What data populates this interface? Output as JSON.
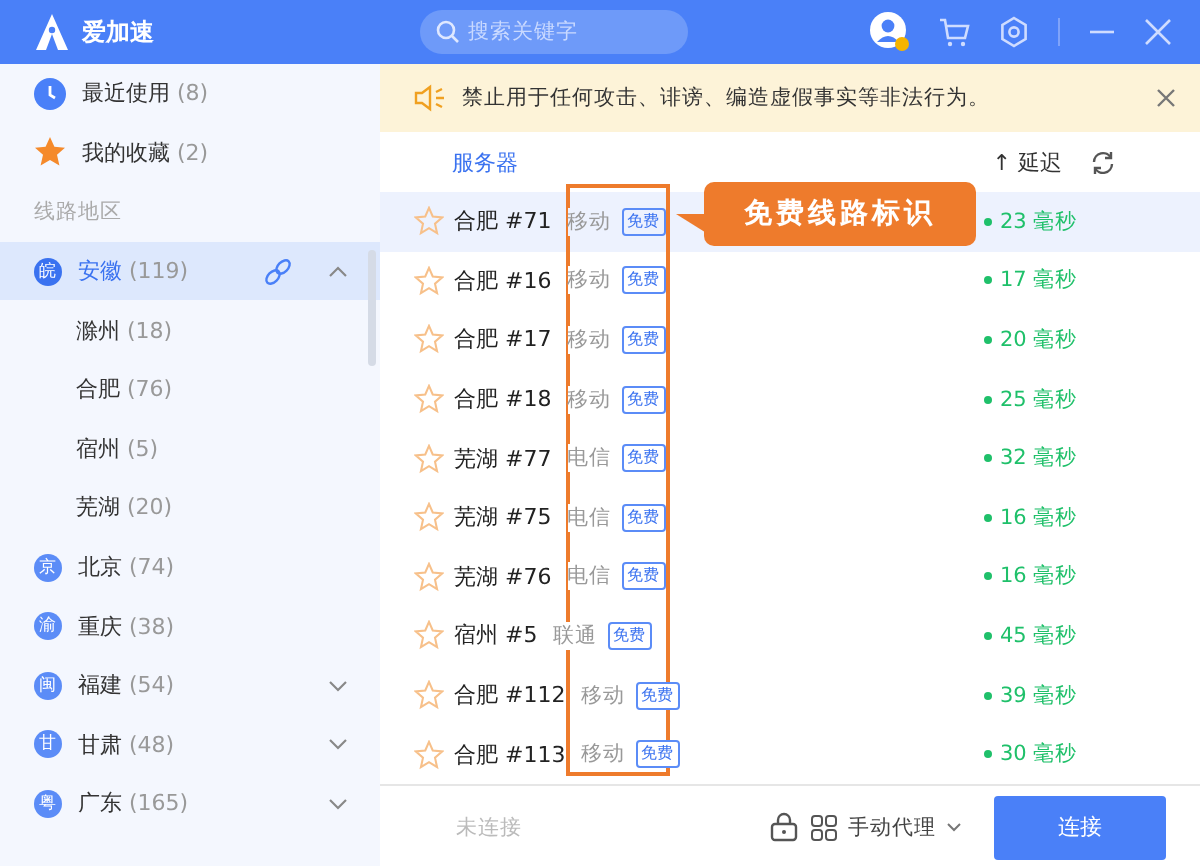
{
  "header": {
    "app_name": "爱加速",
    "search": {
      "placeholder": "搜索关键字"
    }
  },
  "sidebar": {
    "items": [
      {
        "kind": "recent",
        "label": "最近使用",
        "count": "(8)"
      },
      {
        "kind": "favorite",
        "label": "我的收藏",
        "count": "(2)"
      }
    ],
    "section_title": "线路地区",
    "regions": [
      {
        "badge": "皖",
        "label": "安徽",
        "count": "(119)",
        "selected": true,
        "expanded": true,
        "children": [
          {
            "label": "滁州",
            "count": "(18)"
          },
          {
            "label": "合肥",
            "count": "(76)"
          },
          {
            "label": "宿州",
            "count": "(5)"
          },
          {
            "label": "芜湖",
            "count": "(20)"
          }
        ]
      },
      {
        "badge": "京",
        "label": "北京",
        "count": "(74)",
        "selected": false,
        "expanded": false
      },
      {
        "badge": "渝",
        "label": "重庆",
        "count": "(38)",
        "selected": false,
        "expanded": false
      },
      {
        "badge": "闽",
        "label": "福建",
        "count": "(54)",
        "selected": false,
        "expanded": false,
        "expandable": true
      },
      {
        "badge": "甘",
        "label": "甘肃",
        "count": "(48)",
        "selected": false,
        "expanded": false,
        "expandable": true
      },
      {
        "badge": "粤",
        "label": "广东",
        "count": "(165)",
        "selected": false,
        "expanded": false,
        "expandable": true
      }
    ]
  },
  "notice": {
    "text": "禁止用于任何攻击、诽谤、编造虚假事实等非法行为。"
  },
  "list_header": {
    "server": "服务器",
    "latency": "延迟",
    "sort_arrow": "↑"
  },
  "servers": [
    {
      "name": "合肥 #71",
      "carrier": "移动",
      "tag": "免费",
      "latency": "23 毫秒",
      "selected": true
    },
    {
      "name": "合肥 #16",
      "carrier": "移动",
      "tag": "免费",
      "latency": "17 毫秒",
      "selected": false
    },
    {
      "name": "合肥 #17",
      "carrier": "移动",
      "tag": "免费",
      "latency": "20 毫秒",
      "selected": false
    },
    {
      "name": "合肥 #18",
      "carrier": "移动",
      "tag": "免费",
      "latency": "25 毫秒",
      "selected": false
    },
    {
      "name": "芜湖 #77",
      "carrier": "电信",
      "tag": "免费",
      "latency": "32 毫秒",
      "selected": false
    },
    {
      "name": "芜湖 #75",
      "carrier": "电信",
      "tag": "免费",
      "latency": "16 毫秒",
      "selected": false
    },
    {
      "name": "芜湖 #76",
      "carrier": "电信",
      "tag": "免费",
      "latency": "16 毫秒",
      "selected": false
    },
    {
      "name": "宿州 #5",
      "carrier": "联通",
      "tag": "免费",
      "latency": "45 毫秒",
      "selected": false
    },
    {
      "name": "合肥 #112",
      "carrier": "移动",
      "tag": "免费",
      "latency": "39 毫秒",
      "selected": false
    },
    {
      "name": "合肥 #113",
      "carrier": "移动",
      "tag": "免费",
      "latency": "30 毫秒",
      "selected": false
    }
  ],
  "annotation": {
    "text": "免费线路标识"
  },
  "footer": {
    "status": "未连接",
    "proxy_mode": "手动代理",
    "connect_button": "连接"
  }
}
